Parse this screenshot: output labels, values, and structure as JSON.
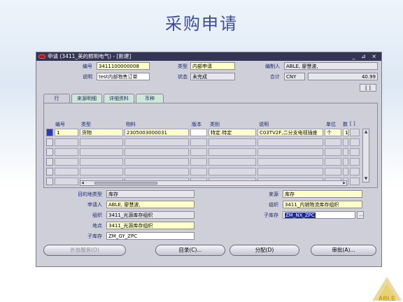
{
  "slide": {
    "title": "采购申请",
    "logo_text": "ABLE"
  },
  "window": {
    "title": "申请 (3411_美的照明电气) - [新建]",
    "controls": "_ ⊿ ×"
  },
  "header": {
    "number_label": "编号",
    "number_value": "3411100000008",
    "type_label": "类型",
    "type_value": "内部申请",
    "preparer_label": "编制人",
    "preparer_value": "ABLE, 廖慧波,",
    "desc_label": "说明",
    "desc_value": "test内部物售订单",
    "status_label": "状态",
    "status_value": "未完成",
    "total_label": "合计",
    "currency_value": "CNY",
    "total_value": "40.99",
    "bracket": "[  ]"
  },
  "tabs": [
    "行",
    "来源明细",
    "详细资料",
    "币种"
  ],
  "grid": {
    "headers": [
      "编号",
      "类型",
      "物料",
      "版本",
      "类别",
      "说明",
      "单位",
      "数",
      "[ ]"
    ],
    "rows": [
      [
        "1",
        "货物",
        "2305003000031",
        "",
        "特定.特定",
        "C03TV2F,二分支电视插座",
        "个",
        "10"
      ]
    ]
  },
  "lower": {
    "dest_type_label": "目的地类型",
    "dest_type_value": "库存",
    "requester_label": "申请人",
    "requester_value": "ABLE, 廖慧波,",
    "org_label": "组织",
    "org_value": "3411_光源库存组织",
    "location_label": "地点",
    "location_value": "3411_光源库存组织",
    "subinv_label": "子库存",
    "subinv_value": "ZM_GY_ZPC",
    "source_label": "来源",
    "source_value": "库存",
    "src_org_label": "组织",
    "src_org_value": "3411_内销物流库存组织",
    "src_subinv_label": "子库存",
    "src_subinv_value": "ZM_NX_ZPC"
  },
  "buttons": {
    "outsource": "外协服务(O)",
    "catalog": "目录(C)...",
    "distribution": "分配(D)",
    "approve": "审批(A)..."
  }
}
